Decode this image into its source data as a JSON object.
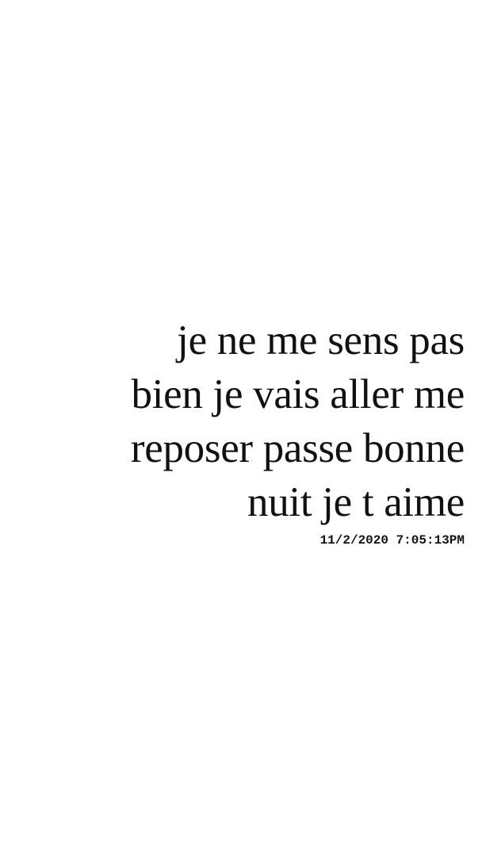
{
  "message": {
    "lines": [
      "je ne me sens pas",
      "bien je vais aller me",
      "reposer passe bonne",
      "nuit je t aime"
    ],
    "timestamp": "11/2/2020 7:05:13PM"
  },
  "colors": {
    "background": "#ffffff",
    "text": "#111111"
  }
}
